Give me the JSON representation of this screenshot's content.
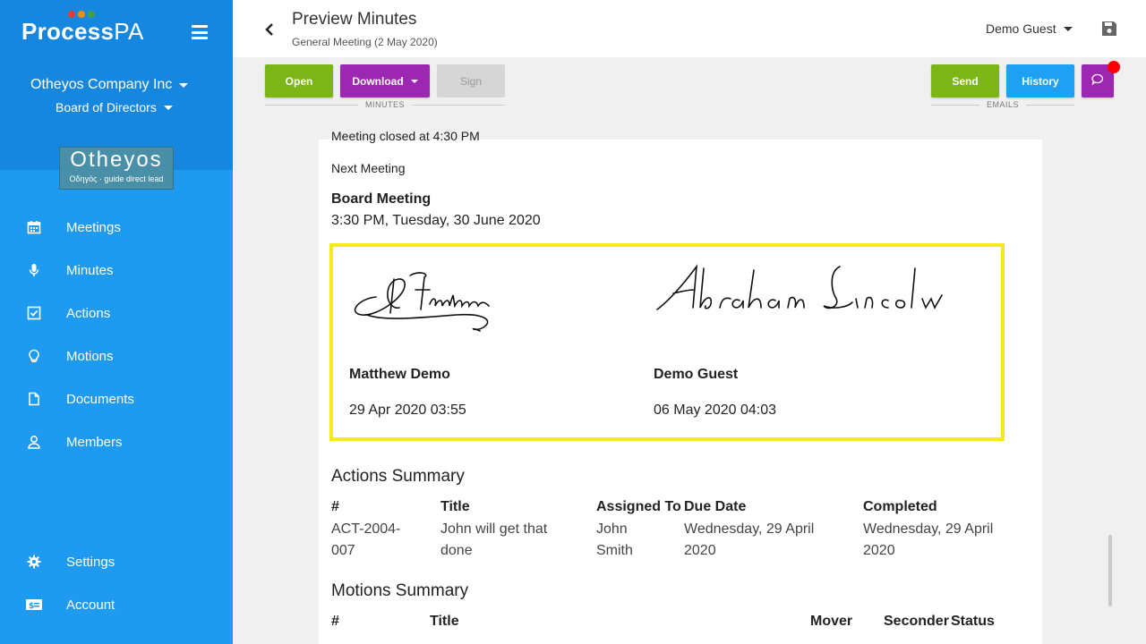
{
  "brand": {
    "name_bold": "Process",
    "name_light": "PA",
    "dot_colors": [
      "#e53935",
      "#fb8c00",
      "#43a047",
      "#1e88e5"
    ]
  },
  "sidebar": {
    "company": "Otheyos Company Inc",
    "board": "Board of Directors",
    "logo": {
      "main": "Otheyos",
      "sub": "Οδηγός · guide direct lead"
    },
    "items": [
      {
        "label": "Meetings",
        "icon": "calendar-icon"
      },
      {
        "label": "Minutes",
        "icon": "microphone-icon"
      },
      {
        "label": "Actions",
        "icon": "checkbox-icon"
      },
      {
        "label": "Motions",
        "icon": "lightbulb-icon"
      },
      {
        "label": "Documents",
        "icon": "document-icon"
      },
      {
        "label": "Members",
        "icon": "person-icon"
      }
    ],
    "bottom_items": [
      {
        "label": "Settings",
        "icon": "gear-icon"
      },
      {
        "label": "Account",
        "icon": "billing-icon"
      }
    ]
  },
  "header": {
    "title": "Preview Minutes",
    "subtitle": "General Meeting (2 May 2020)",
    "user": "Demo Guest"
  },
  "toolbar": {
    "open_label": "Open",
    "download_label": "Download",
    "sign_label": "Sign",
    "minutes_group_label": "MINUTES",
    "send_label": "Send",
    "history_label": "History",
    "emails_group_label": "EMAILS"
  },
  "document": {
    "cut_text": "Meeting closed at 4:30 PM",
    "next_meeting_label": "Next Meeting",
    "next_meeting_type": "Board Meeting",
    "next_meeting_time": "3:30 PM, Tuesday, 30 June 2020",
    "signatures": [
      {
        "name": "Matthew Demo",
        "date": "29 Apr 2020 03:55"
      },
      {
        "name": "Demo Guest",
        "date": "06 May 2020 04:03"
      }
    ],
    "actions_summary": {
      "title": "Actions Summary",
      "headers": [
        "#",
        "Title",
        "Assigned To",
        "Due Date",
        "Completed"
      ],
      "row": {
        "id": [
          "ACT-2004-",
          "007"
        ],
        "title": [
          "John will get that",
          "done"
        ],
        "assigned": [
          "John",
          "Smith"
        ],
        "due": [
          "Wednesday, 29 April",
          "2020"
        ],
        "completed": [
          "Wednesday, 29 April",
          "2020"
        ]
      }
    },
    "motions_summary": {
      "title": "Motions Summary",
      "headers": [
        "#",
        "Title",
        "Mover",
        "Seconder",
        "Status"
      ]
    }
  },
  "colors": {
    "sidebar": "#1e9bf0",
    "sidebar_top": "#1687de",
    "green": "#7cb518",
    "purple": "#9c27b0",
    "blue": "#1ea1f2",
    "highlight": "#f5eb1a"
  }
}
